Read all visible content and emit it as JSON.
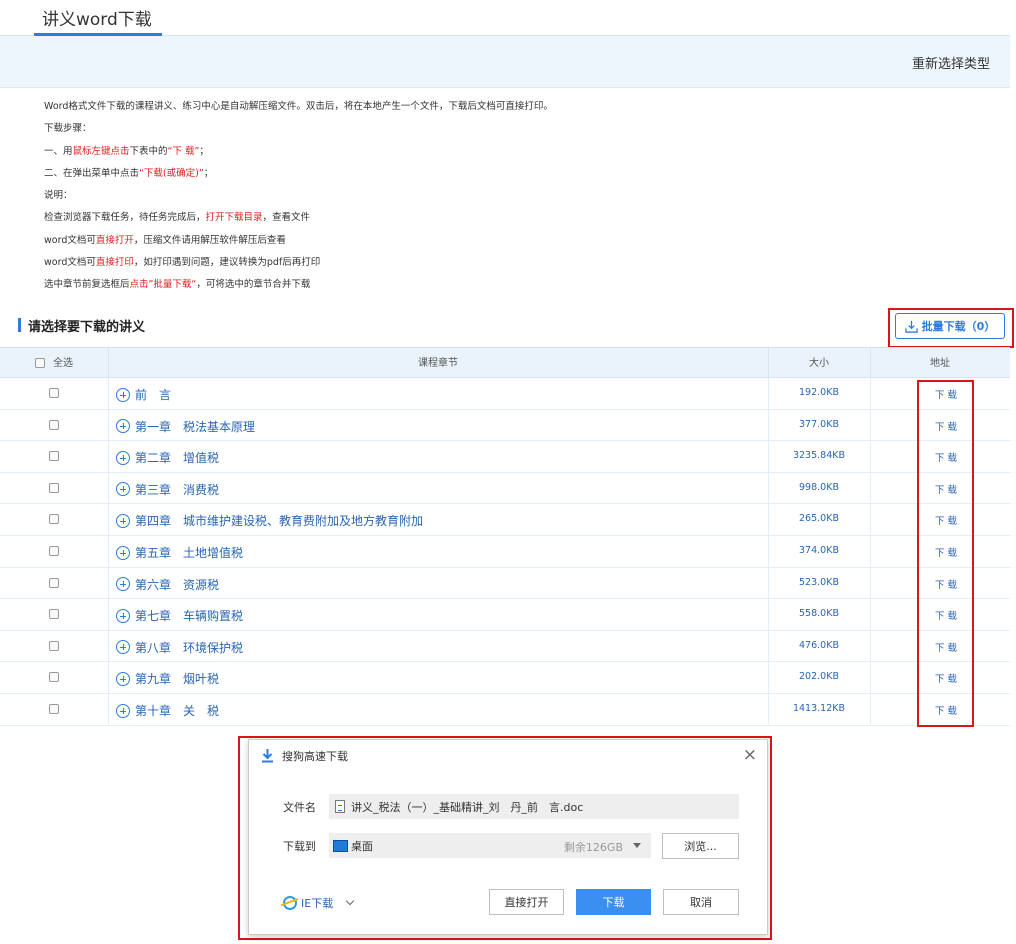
{
  "tab": {
    "title": "讲义word下载"
  },
  "header": {
    "rechoose_label": "重新选择类型"
  },
  "instructions": {
    "l1": "Word格式文件下载的课程讲义、练习中心是自动解压缩文件。双击后，将在本地产生一个文件，下载后文档可直接打印。",
    "l2": "下载步骤：",
    "l3a": "一、用",
    "l3b": "鼠标左键点击",
    "l3c": "下表中的",
    "l3d": "“下 载”",
    "l3e": "；",
    "l4a": "二、在弹出菜单中点击",
    "l4b": "“下载(或确定)”",
    "l4c": "；",
    "l5": "说明：",
    "l6a": "检查浏览器下载任务，待任务完成后，",
    "l6b": "打开下载目录",
    "l6c": "，查看文件",
    "l7a": "word文档可",
    "l7b": "直接打开",
    "l7c": "，压缩文件请用解压软件解压后查看",
    "l8a": "word文档可",
    "l8b": "直接打印",
    "l8c": "，如打印遇到问题，建议转换为pdf后再打印",
    "l9a": "选中章节前复选框后",
    "l9b": "点击”批量下载“",
    "l9c": "，可将选中的章节合并下载"
  },
  "section": {
    "title": "请选择要下载的讲义",
    "batch_label": "批量下载（0）"
  },
  "table": {
    "headers": {
      "select_all": "全选",
      "chapter": "课程章节",
      "size": "大小",
      "address": "地址"
    },
    "rows": [
      {
        "chapter": "前　言",
        "size": "192.0KB",
        "action": "下 载"
      },
      {
        "chapter": "第一章　税法基本原理",
        "size": "377.0KB",
        "action": "下 载"
      },
      {
        "chapter": "第二章　增值税",
        "size": "3235.84KB",
        "action": "下 载"
      },
      {
        "chapter": "第三章　消费税",
        "size": "998.0KB",
        "action": "下 载"
      },
      {
        "chapter": "第四章　城市维护建设税、教育费附加及地方教育附加",
        "size": "265.0KB",
        "action": "下 载"
      },
      {
        "chapter": "第五章　土地增值税",
        "size": "374.0KB",
        "action": "下 载"
      },
      {
        "chapter": "第六章　资源税",
        "size": "523.0KB",
        "action": "下 载"
      },
      {
        "chapter": "第七章　车辆购置税",
        "size": "558.0KB",
        "action": "下 载"
      },
      {
        "chapter": "第八章　环境保护税",
        "size": "476.0KB",
        "action": "下 载"
      },
      {
        "chapter": "第九章　烟叶税",
        "size": "202.0KB",
        "action": "下 载"
      },
      {
        "chapter": "第十章　关　税",
        "size": "1413.12KB",
        "action": "下 载"
      }
    ]
  },
  "dialog": {
    "title": "搜狗高速下载",
    "filename_label": "文件名",
    "filename": "讲义_税法（一）_基础精讲_刘　丹_前　言.doc",
    "dest_label": "下载到",
    "dest": "桌面",
    "free_space": "剩余126GB",
    "browse": "浏览...",
    "ie_download": "IE下载",
    "open_direct": "直接打开",
    "download": "下载",
    "cancel": "取消"
  },
  "colors": {
    "accent": "#2e7ce0",
    "highlight": "#d9161b",
    "link": "#2a64b4"
  }
}
